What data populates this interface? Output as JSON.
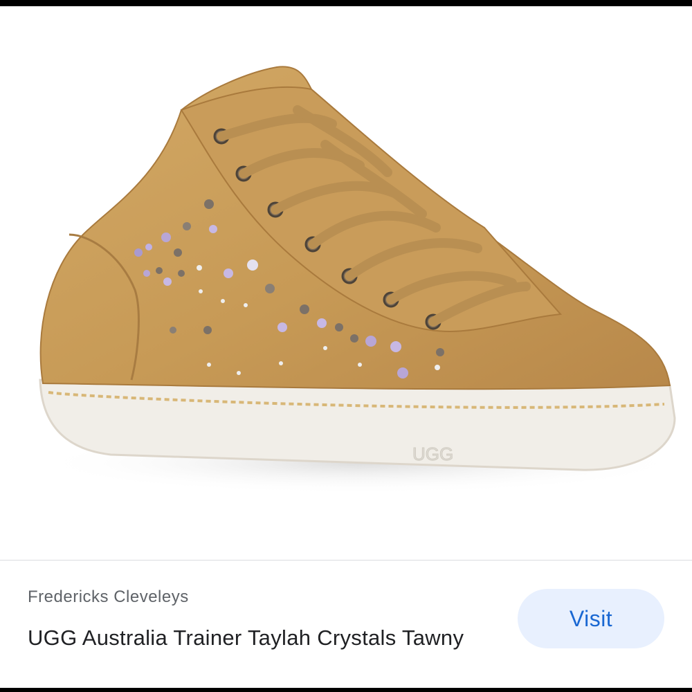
{
  "result": {
    "source": "Fredericks Cleveleys",
    "title": "UGG Australia Trainer Taylah Crystals Tawny",
    "visit_label": "Visit",
    "sole_logo": "UGG"
  },
  "colors": {
    "suede": "#c79a56",
    "laces": "#b98f52",
    "sole": "#f1eee8",
    "visit_bg": "#e8f0fe",
    "visit_text": "#1967d2"
  }
}
